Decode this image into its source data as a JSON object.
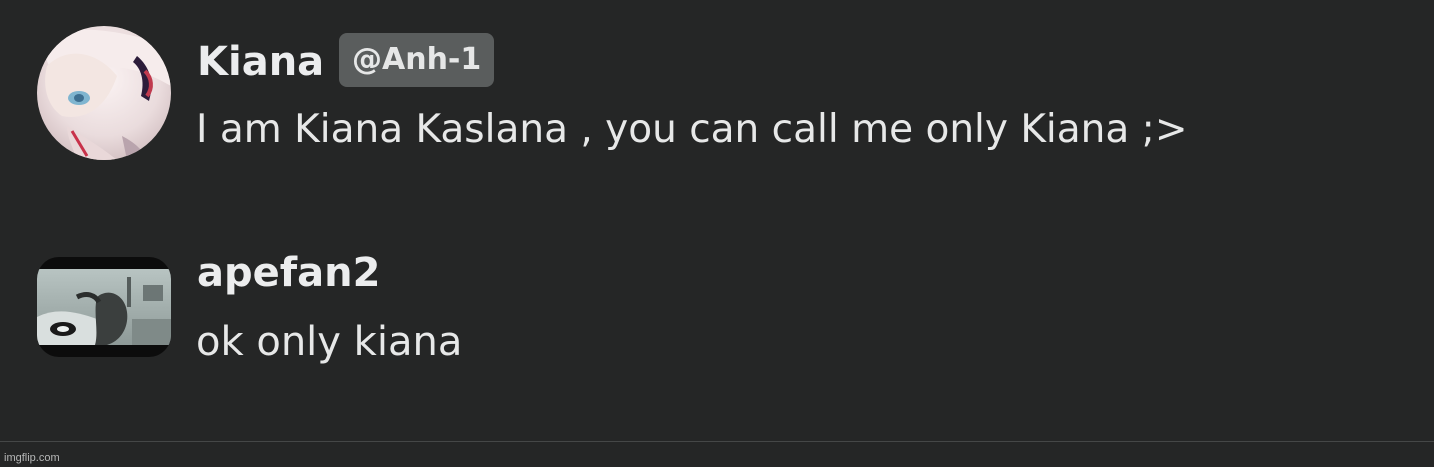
{
  "messages": [
    {
      "username": "Kiana",
      "handle": "@Anh-1",
      "text": "I am Kiana Kaslana , you can call me only Kiana ;>",
      "avatar_icon": "anime-girl-avatar-icon"
    },
    {
      "username": "apefan2",
      "text": "ok only kiana",
      "avatar_icon": "ape-photo-avatar-icon"
    }
  ],
  "footer": {
    "watermark": "imgflip.com"
  },
  "colors": {
    "background": "#252626",
    "badge_background": "#5a5d5d",
    "text": "#ecedee"
  }
}
